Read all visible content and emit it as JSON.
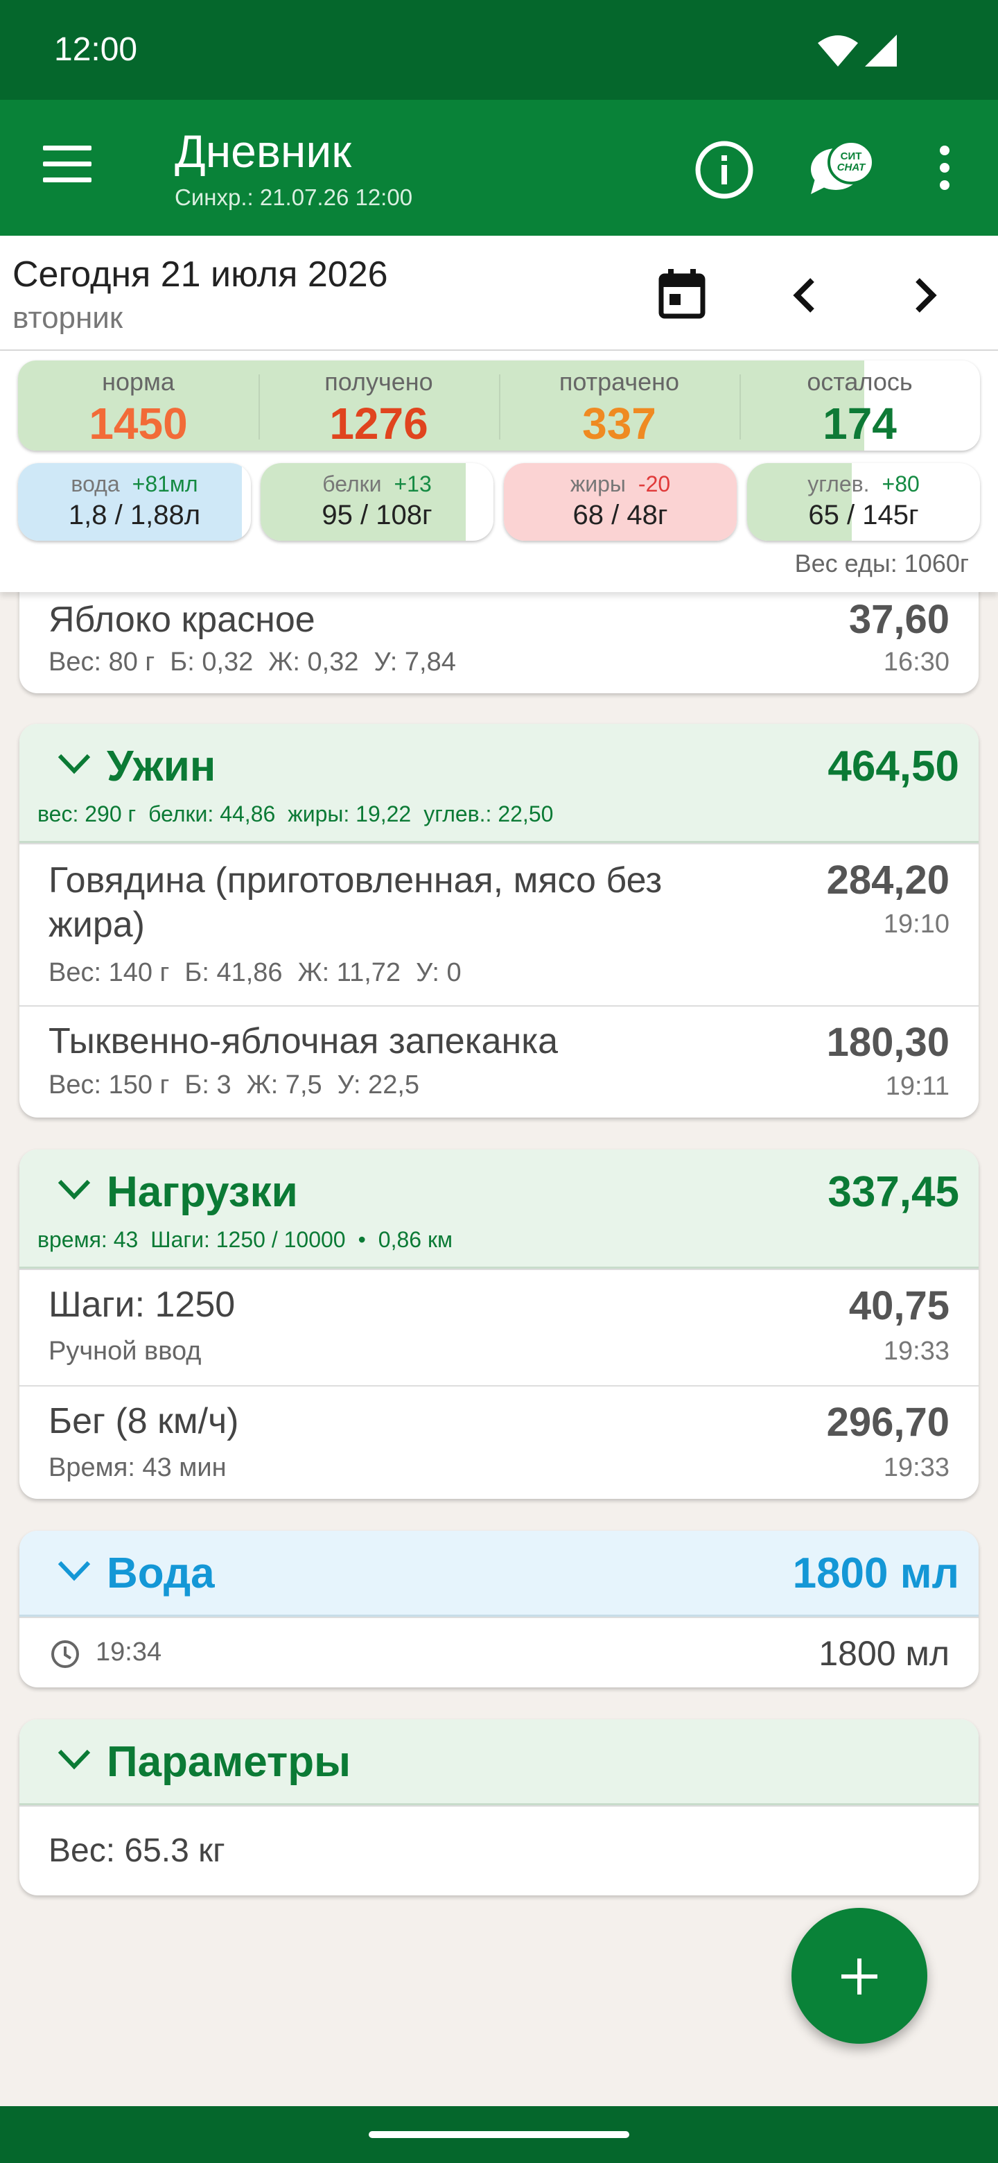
{
  "status": {
    "time": "12:00"
  },
  "appbar": {
    "title": "Дневник",
    "sync": "Синхр.: 21.07.26 12:00",
    "chat_top": "СИТ",
    "chat_bottom": "CHAT"
  },
  "date": {
    "label": "Сегодня 21 июля 2026",
    "weekday": "вторник"
  },
  "totals": [
    {
      "label": "норма",
      "value": "1450",
      "color": "#f26b38"
    },
    {
      "label": "получено",
      "value": "1276",
      "color": "#e0441e"
    },
    {
      "label": "потрачено",
      "value": "337",
      "color": "#ef8a22"
    },
    {
      "label": "осталось",
      "value": "174",
      "color": "#0e7a36"
    }
  ],
  "totals_progress": 0.88,
  "macros": [
    {
      "label": "вода",
      "delta": "+81мл",
      "value": "1,8 / 1,88л",
      "fill": "#cfe8f7",
      "delta_color": "#148a42",
      "progress": 0.96
    },
    {
      "label": "белки",
      "delta": "+13",
      "value": "95 / 108г",
      "fill": "#cfe7c8",
      "delta_color": "#148a42",
      "progress": 0.88
    },
    {
      "label": "жиры",
      "delta": "-20",
      "value": "68 / 48г",
      "fill": "#fbd3d3",
      "delta_color": "#e03a3a",
      "progress": 1.0
    },
    {
      "label": "углев.",
      "delta": "+80",
      "value": "65 / 145г",
      "fill": "#cfe7c8",
      "delta_color": "#148a42",
      "progress": 0.45
    }
  ],
  "food_weight": "Вес еды: 1060г",
  "snack_item": {
    "name": "Яблоко красное",
    "details": [
      "Вес: 80 г",
      "Б: 0,32",
      "Ж: 0,32",
      "У: 7,84"
    ],
    "kcal": "37,60",
    "time": "16:30"
  },
  "dinner": {
    "title": "Ужин",
    "total": "464,50",
    "summary": [
      "вес: 290 г",
      "белки: 44,86",
      "жиры: 19,22",
      "углев.: 22,50"
    ],
    "items": [
      {
        "name_line1": "Говядина (приготовленная, мясо без",
        "name_line2": "жира)",
        "details": [
          "Вес: 140 г",
          "Б: 41,86",
          "Ж: 11,72",
          "У: 0"
        ],
        "kcal": "284,20",
        "time": "19:10"
      },
      {
        "name": "Тыквенно-яблочная запеканка",
        "details": [
          "Вес: 150 г",
          "Б: 3",
          "Ж: 7,5",
          "У: 22,5"
        ],
        "kcal": "180,30",
        "time": "19:11"
      }
    ]
  },
  "activity": {
    "title": "Нагрузки",
    "total": "337,45",
    "summary": [
      "время: 43",
      "Шаги: 1250 / 10000",
      "•",
      "0,86 км"
    ],
    "items": [
      {
        "name": "Шаги: 1250",
        "detail": "Ручной ввод",
        "kcal": "40,75",
        "time": "19:33"
      },
      {
        "name": "Бег (8 км/ч)",
        "detail": "Время: 43 мин",
        "kcal": "296,70",
        "time": "19:33"
      }
    ]
  },
  "water": {
    "title": "Вода",
    "total": "1800 мл",
    "entry_time": "19:34",
    "entry_amount": "1800 мл"
  },
  "params": {
    "title": "Параметры",
    "weight": "Вес: 65.3 кг"
  }
}
